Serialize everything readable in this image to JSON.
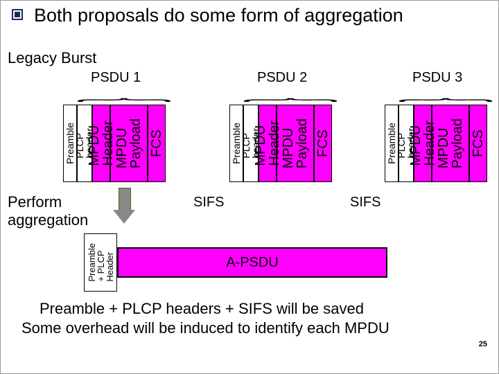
{
  "title": "Both proposals do some form of aggregation",
  "legacy_label": "Legacy Burst",
  "psdu": {
    "p1": "PSDU 1",
    "p2": "PSDU 2",
    "p3": "PSDU 3"
  },
  "cells": {
    "preamble": "Preamble",
    "plcp": "PLCP\nheader",
    "mpdu_hdr": "MPDU\nHeader",
    "mpdu_pay": "MPDU\nPayload",
    "fcs": "FCS"
  },
  "sifs": "SIFS",
  "perform": "Perform\naggregation",
  "agg_pre": "Preamble\n+ PLCP\nHeader",
  "agg_body": "A-PSDU",
  "conclude1": "Preamble + PLCP headers + SIFS will be saved",
  "conclude2": "Some overhead will be induced to identify each MPDU",
  "pagenum": "25",
  "colors": {
    "mpdu_fill": "#ff00ff"
  }
}
